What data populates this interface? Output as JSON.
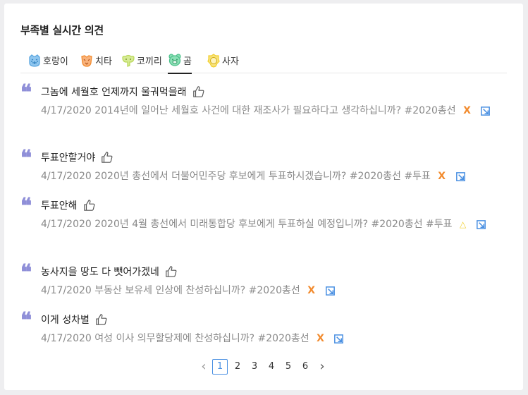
{
  "header": {
    "title": "부족별 실시간 의견"
  },
  "tabs": [
    {
      "label": "호랑이",
      "icon": "tiger-icon",
      "color": "#5aa6e0"
    },
    {
      "label": "치타",
      "icon": "cheetah-icon",
      "color": "#f28b2e"
    },
    {
      "label": "코끼리",
      "icon": "elephant-icon",
      "color": "#b9d85a"
    },
    {
      "label": "곰",
      "icon": "bear-icon",
      "color": "#4cc08a",
      "active": true
    },
    {
      "label": "사자",
      "icon": "lion-icon",
      "color": "#f2cf2e"
    }
  ],
  "opinions": [
    {
      "text": "그놈에 세월호 언제까지 울궈먹을래",
      "question": "4/17/2020 2014년에 일어난 세월호 사건에 대한 재조사가 필요하다고 생각하십니까? #2020총선",
      "mark": "X"
    },
    {
      "text": "투표안할거야",
      "question": "4/17/2020 2020년 총선에서 더불어민주당 후보에게 투표하시겠습니까? #2020총선 #투표",
      "mark": "X"
    },
    {
      "text": "투표안해",
      "question": "4/17/2020 2020년 4월 총선에서 미래통합당 후보에게 투표하실 예정입니까? #2020총선 #투표",
      "mark": "△"
    },
    {
      "text": "농사지을 땅도 다 뺏어가겠네",
      "question": "4/17/2020 부동산 보유세 인상에 찬성하십니까? #2020총선",
      "mark": "X"
    },
    {
      "text": "이게 성차별",
      "question": "4/17/2020 여성 이사 의무할당제에 찬성하십니까? #2020총선",
      "mark": "X"
    }
  ],
  "pagination": {
    "prev": "‹",
    "next": "›",
    "pages": [
      "1",
      "2",
      "3",
      "4",
      "5",
      "6"
    ],
    "current": "1"
  },
  "colors": {
    "accent": "#4a90e2",
    "quote": "#8f8fd8",
    "mark_x": "#f28b2e",
    "mark_triangle": "#f2cf2e"
  }
}
